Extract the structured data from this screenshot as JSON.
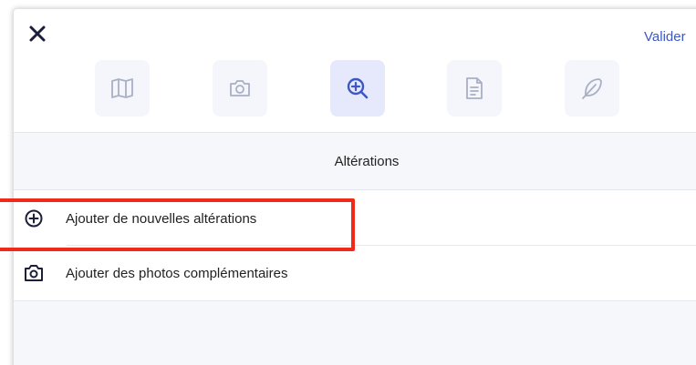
{
  "header": {
    "close_icon": "close-icon",
    "validate_label": "Valider"
  },
  "toolbar": {
    "tools": [
      {
        "icon": "book-icon",
        "active": false
      },
      {
        "icon": "camera-icon",
        "active": false
      },
      {
        "icon": "zoom-in-icon",
        "active": true
      },
      {
        "icon": "document-icon",
        "active": false
      },
      {
        "icon": "feather-icon",
        "active": false
      }
    ]
  },
  "section": {
    "title": "Altérations"
  },
  "actions": [
    {
      "icon": "plus-circle-icon",
      "label": "Ajouter de nouvelles altérations",
      "highlighted": true
    },
    {
      "icon": "camera-icon",
      "label": "Ajouter des photos complémentaires",
      "highlighted": false
    }
  ],
  "colors": {
    "accent": "#3d57c4",
    "tool_bg": "#f4f6fc",
    "tool_active_bg": "#e5e9fb",
    "icon_muted": "#a9b0c4",
    "highlight": "#ee2a1b"
  }
}
